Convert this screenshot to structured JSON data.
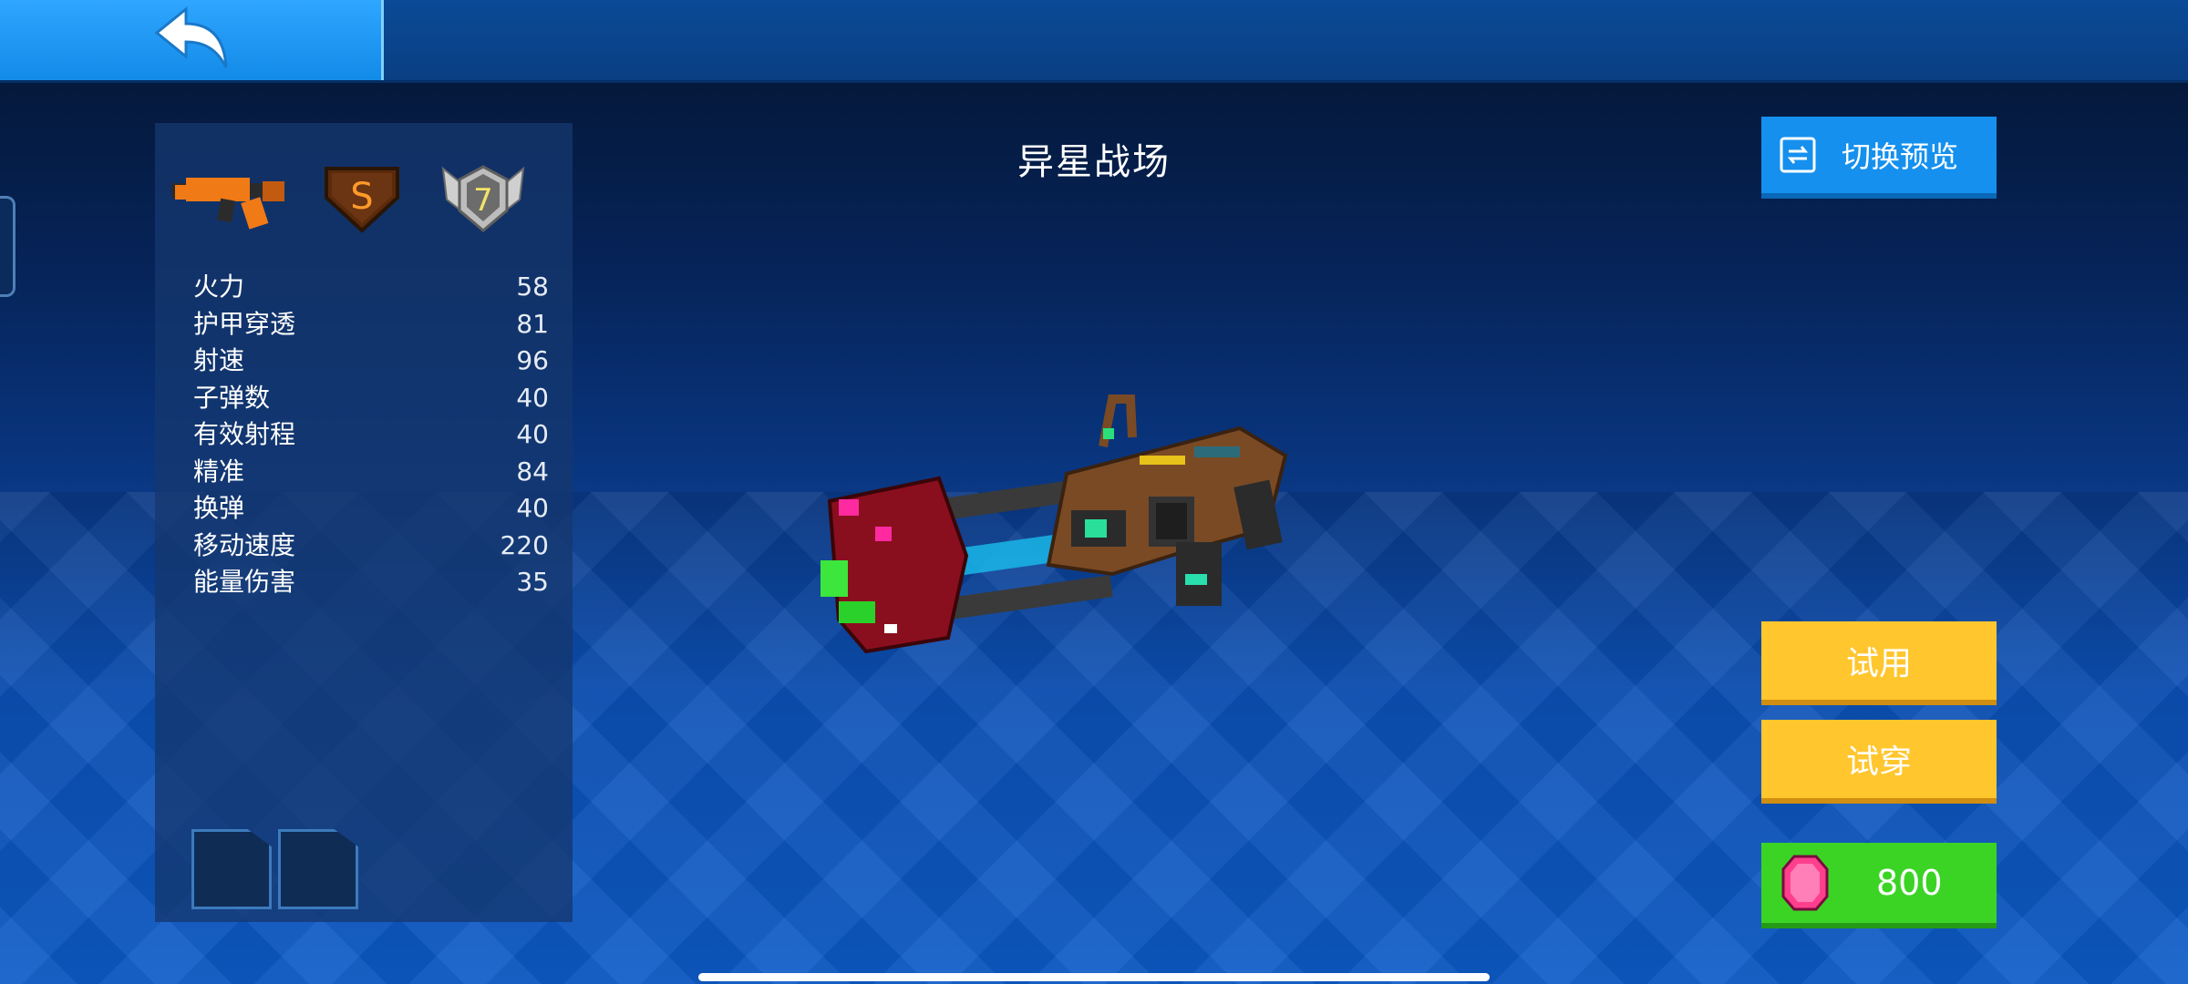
{
  "header": {
    "back_icon": "back-arrow-icon"
  },
  "title": "异星战场",
  "badges": {
    "weapon_icon": "rifle-icon",
    "rarity": "S",
    "level": "7"
  },
  "stats": [
    {
      "label": "火力",
      "value": "58"
    },
    {
      "label": "护甲穿透",
      "value": "81"
    },
    {
      "label": "射速",
      "value": "96"
    },
    {
      "label": "子弹数",
      "value": "40"
    },
    {
      "label": "有效射程",
      "value": "40"
    },
    {
      "label": "精准",
      "value": "84"
    },
    {
      "label": "换弹",
      "value": "40"
    },
    {
      "label": "移动速度",
      "value": "220"
    },
    {
      "label": "能量伤害",
      "value": "35"
    }
  ],
  "buttons": {
    "preview": "切换预览",
    "try_use": "试用",
    "try_wear": "试穿",
    "price": "800"
  },
  "colors": {
    "accent_blue": "#1590ee",
    "yellow": "#ffc62e",
    "green": "#3bd425",
    "gem": "#ff3f8e"
  }
}
